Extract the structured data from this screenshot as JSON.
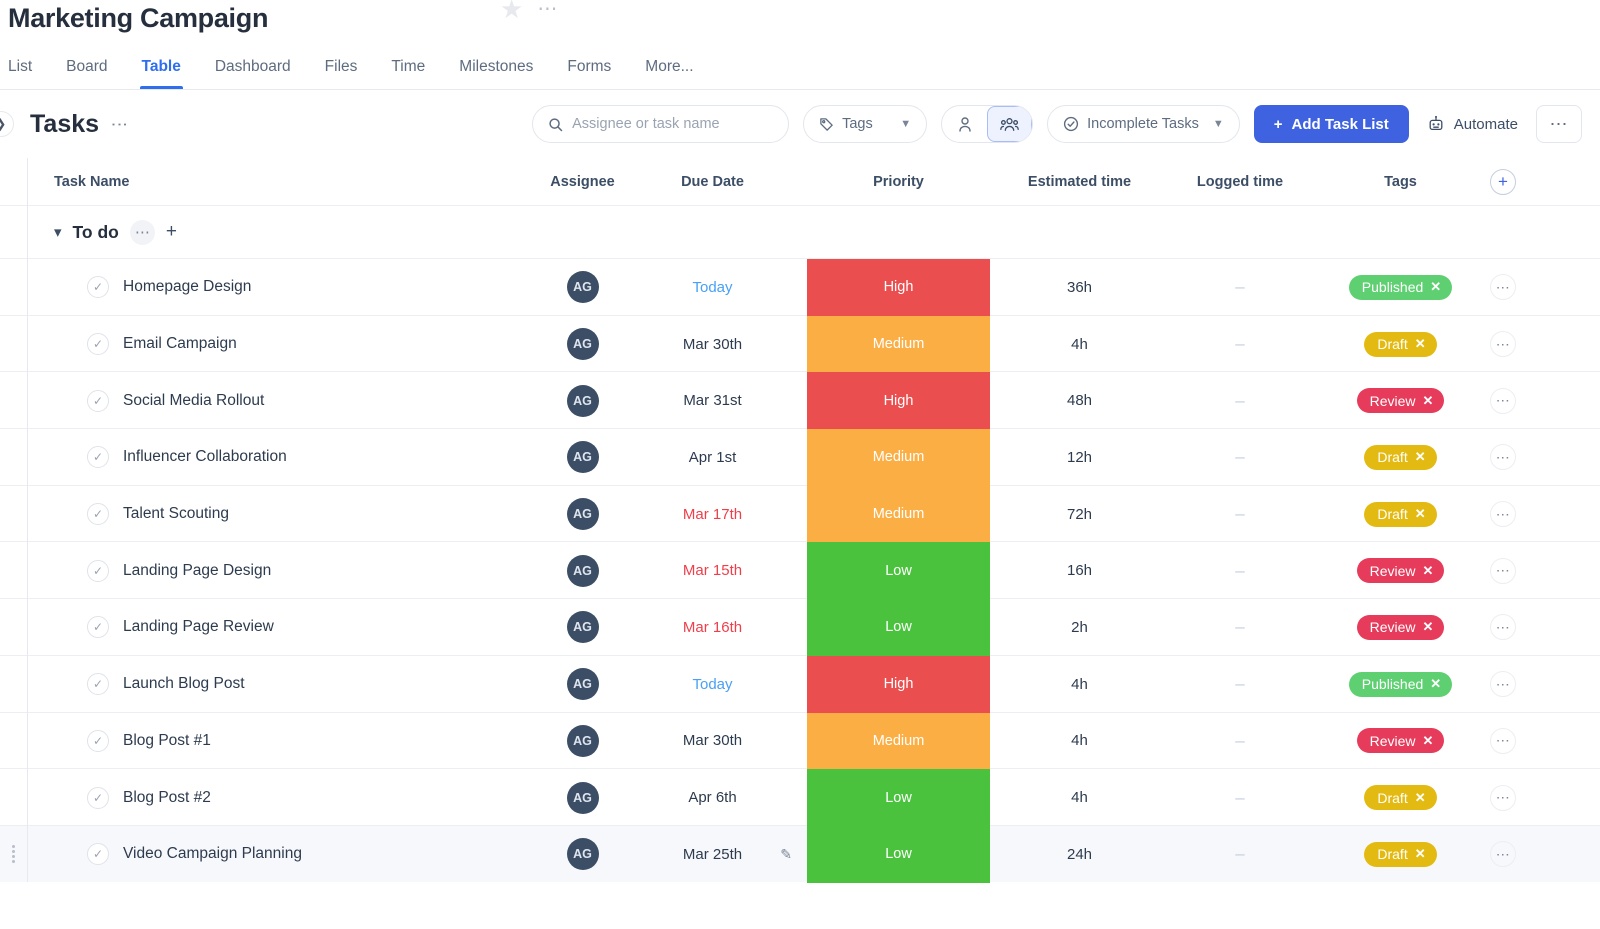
{
  "header": {
    "project_title": "Marketing Campaign",
    "star_icon": "star-icon",
    "more_icon": "⋯"
  },
  "tabs": [
    {
      "label": "List",
      "active": false
    },
    {
      "label": "Board",
      "active": false
    },
    {
      "label": "Table",
      "active": true
    },
    {
      "label": "Dashboard",
      "active": false
    },
    {
      "label": "Files",
      "active": false
    },
    {
      "label": "Time",
      "active": false
    },
    {
      "label": "Milestones",
      "active": false
    },
    {
      "label": "Forms",
      "active": false
    },
    {
      "label": "More...",
      "active": false
    }
  ],
  "toolbar": {
    "section_title": "Tasks",
    "search_placeholder": "Assignee or task name",
    "search_value": "",
    "tags_label": "Tags",
    "filter_label": "Incomplete Tasks",
    "add_task_list_label": "Add Task List",
    "automate_label": "Automate",
    "more_label": "⋯"
  },
  "columns": {
    "task_name": "Task Name",
    "assignee": "Assignee",
    "due_date": "Due Date",
    "priority": "Priority",
    "estimated_time": "Estimated time",
    "logged_time": "Logged time",
    "tags": "Tags",
    "add_column": "+"
  },
  "group": {
    "name": "To do",
    "more": "⋯",
    "add": "+"
  },
  "colors": {
    "accent_blue": "#3f63e0",
    "tab_active": "#2f6fed",
    "priority_high": "#ea4e4e",
    "priority_medium": "#fbae44",
    "priority_low": "#4bc23e",
    "tag_published": "#5fd072",
    "tag_draft": "#e3ba12",
    "tag_review": "#e63b5b",
    "date_today": "#49a0f5",
    "date_overdue": "#ef3f4a",
    "avatar_bg": "#3c4e66"
  },
  "rows": [
    {
      "name": "Homepage Design",
      "avatar": "AG",
      "due": "Today",
      "due_state": "today",
      "priority": "High",
      "priority_color": "#ea4e4e",
      "estimated": "36h",
      "logged": "–",
      "tag": "Published",
      "tag_color": "#5fd072",
      "has_pencil": false,
      "highlight": false
    },
    {
      "name": "Email Campaign",
      "avatar": "AG",
      "due": "Mar 30th",
      "due_state": "normal",
      "priority": "Medium",
      "priority_color": "#fbae44",
      "estimated": "4h",
      "logged": "–",
      "tag": "Draft",
      "tag_color": "#e3ba12",
      "has_pencil": false,
      "highlight": false
    },
    {
      "name": "Social Media Rollout",
      "avatar": "AG",
      "due": "Mar 31st",
      "due_state": "normal",
      "priority": "High",
      "priority_color": "#ea4e4e",
      "estimated": "48h",
      "logged": "–",
      "tag": "Review",
      "tag_color": "#e63b5b",
      "has_pencil": false,
      "highlight": false
    },
    {
      "name": "Influencer Collaboration",
      "avatar": "AG",
      "due": "Apr 1st",
      "due_state": "normal",
      "priority": "Medium",
      "priority_color": "#fbae44",
      "estimated": "12h",
      "logged": "–",
      "tag": "Draft",
      "tag_color": "#e3ba12",
      "has_pencil": false,
      "highlight": false
    },
    {
      "name": "Talent Scouting",
      "avatar": "AG",
      "due": "Mar 17th",
      "due_state": "overdue",
      "priority": "Medium",
      "priority_color": "#fbae44",
      "estimated": "72h",
      "logged": "–",
      "tag": "Draft",
      "tag_color": "#e3ba12",
      "has_pencil": false,
      "highlight": false
    },
    {
      "name": "Landing Page Design",
      "avatar": "AG",
      "due": "Mar 15th",
      "due_state": "overdue",
      "priority": "Low",
      "priority_color": "#4bc23e",
      "estimated": "16h",
      "logged": "–",
      "tag": "Review",
      "tag_color": "#e63b5b",
      "has_pencil": false,
      "highlight": false
    },
    {
      "name": "Landing Page Review",
      "avatar": "AG",
      "due": "Mar 16th",
      "due_state": "overdue",
      "priority": "Low",
      "priority_color": "#4bc23e",
      "estimated": "2h",
      "logged": "–",
      "tag": "Review",
      "tag_color": "#e63b5b",
      "has_pencil": false,
      "highlight": false
    },
    {
      "name": "Launch Blog Post",
      "avatar": "AG",
      "due": "Today",
      "due_state": "today",
      "priority": "High",
      "priority_color": "#ea4e4e",
      "estimated": "4h",
      "logged": "–",
      "tag": "Published",
      "tag_color": "#5fd072",
      "has_pencil": false,
      "highlight": false
    },
    {
      "name": "Blog Post #1",
      "avatar": "AG",
      "due": "Mar 30th",
      "due_state": "normal",
      "priority": "Medium",
      "priority_color": "#fbae44",
      "estimated": "4h",
      "logged": "–",
      "tag": "Review",
      "tag_color": "#e63b5b",
      "has_pencil": false,
      "highlight": false
    },
    {
      "name": "Blog Post #2",
      "avatar": "AG",
      "due": "Apr 6th",
      "due_state": "normal",
      "priority": "Low",
      "priority_color": "#4bc23e",
      "estimated": "4h",
      "logged": "–",
      "tag": "Draft",
      "tag_color": "#e3ba12",
      "has_pencil": false,
      "highlight": false
    },
    {
      "name": "Video Campaign Planning",
      "avatar": "AG",
      "due": "Mar 25th",
      "due_state": "normal",
      "priority": "Low",
      "priority_color": "#4bc23e",
      "estimated": "24h",
      "logged": "–",
      "tag": "Draft",
      "tag_color": "#e3ba12",
      "has_pencil": true,
      "highlight": true
    }
  ]
}
